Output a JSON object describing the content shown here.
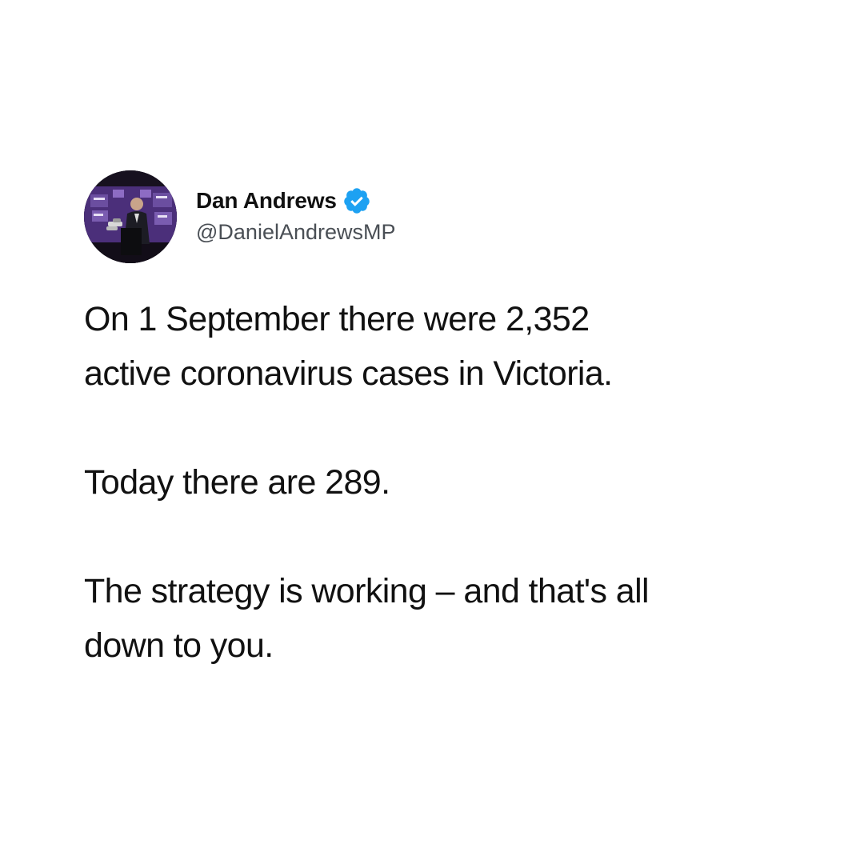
{
  "tweet": {
    "author": {
      "display_name": "Dan Andrews",
      "handle": "@DanielAndrewsMP",
      "verified": true,
      "avatar": "avatar-photo"
    },
    "paragraphs": [
      {
        "lines": [
          "On 1 September there were 2,352",
          "active coronavirus cases in Victoria."
        ]
      },
      {
        "lines": [
          "Today there are 289."
        ]
      },
      {
        "lines": [
          "The strategy is working – and that's all",
          "down to you."
        ]
      }
    ]
  },
  "colors": {
    "verified_badge": "#1da1f2",
    "text": "#111111",
    "handle": "#4a4f55",
    "background": "#ffffff"
  },
  "icons": {
    "verified": "verified-badge-icon"
  }
}
